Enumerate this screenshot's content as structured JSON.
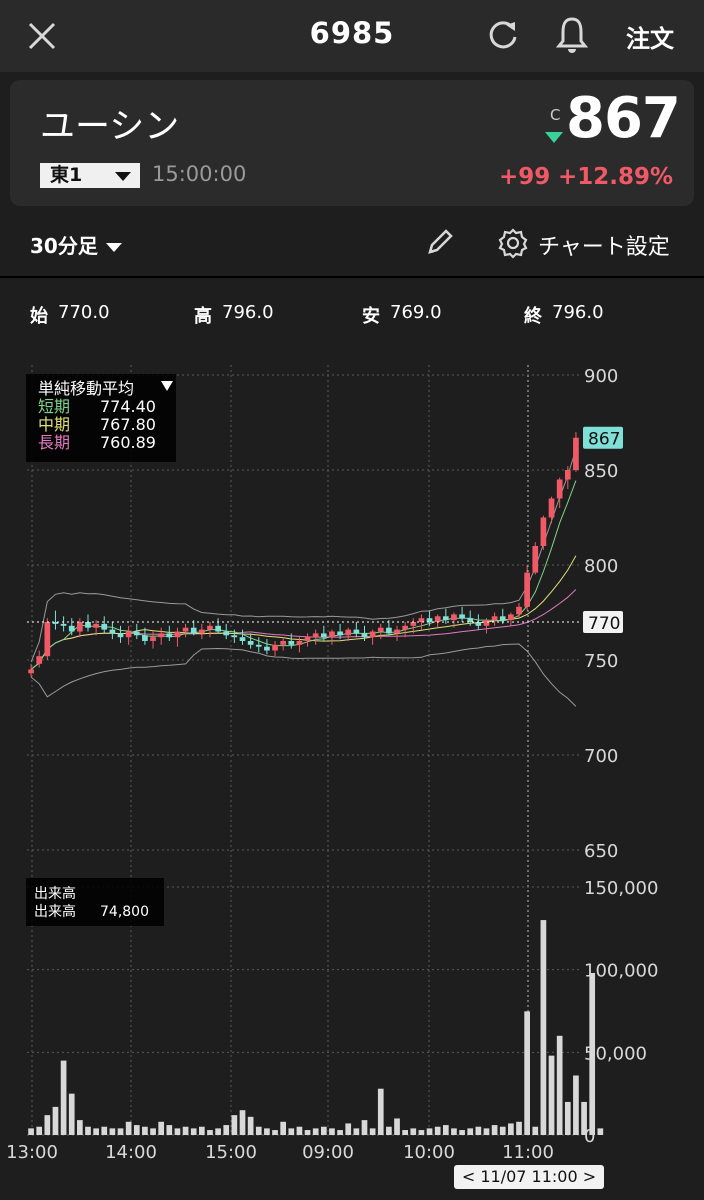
{
  "header": {
    "code": "6985",
    "order_label": "注文",
    "icons": [
      "close-icon",
      "refresh-icon",
      "bell-icon"
    ]
  },
  "stock": {
    "name": "ユーシン",
    "market": "東1",
    "time": "15:00:00",
    "close_mark": "C",
    "price": "867",
    "change": "+99",
    "change_pct": "+12.89%",
    "up_color": "#f05a67",
    "down_color": "#3ad19b"
  },
  "toolbar": {
    "interval": "30分足",
    "settings_label": "チャート設定",
    "icons": [
      "pencil-icon",
      "gear-icon"
    ]
  },
  "ohlc": {
    "open_label": "始",
    "open": "770.0",
    "high_label": "高",
    "high": "796.0",
    "low_label": "安",
    "low": "769.0",
    "close_label": "終",
    "close": "796.0"
  },
  "chart_data": {
    "type": "candlestick",
    "price_axis": {
      "ticks": [
        "900",
        "850",
        "800",
        "750",
        "700",
        "650"
      ],
      "ylim": [
        650,
        900
      ],
      "current_tag": "867",
      "hline_tag": "770"
    },
    "ma_legend": {
      "title": "単純移動平均",
      "short_label": "短期",
      "short_value": "774.40",
      "mid_label": "中期",
      "mid_value": "767.80",
      "long_label": "長期",
      "long_value": "760.89",
      "short_color": "#7fd48a",
      "mid_color": "#e0e07a",
      "long_color": "#e07ac0"
    },
    "volume_legend": {
      "title": "出来高",
      "label": "出来高",
      "value": "74,800"
    },
    "volume_axis": {
      "ticks": [
        "150,000",
        "100,000",
        "50,000",
        "0"
      ],
      "ylim": [
        0,
        150000
      ]
    },
    "x_labels": [
      "13:00",
      "14:00",
      "15:00",
      "09:00",
      "10:00",
      "11:00"
    ],
    "candles_ohlc": [
      [
        743,
        748,
        741,
        745
      ],
      [
        748,
        755,
        746,
        752
      ],
      [
        752,
        772,
        750,
        770
      ],
      [
        770,
        776,
        766,
        769
      ],
      [
        769,
        773,
        765,
        768
      ],
      [
        768,
        772,
        763,
        765
      ],
      [
        765,
        772,
        762,
        770
      ],
      [
        770,
        774,
        765,
        767
      ],
      [
        767,
        771,
        763,
        769
      ],
      [
        769,
        773,
        764,
        766
      ],
      [
        766,
        770,
        761,
        764
      ],
      [
        764,
        768,
        759,
        762
      ],
      [
        762,
        768,
        758,
        765
      ],
      [
        765,
        769,
        761,
        763
      ],
      [
        763,
        767,
        758,
        760
      ],
      [
        760,
        765,
        756,
        762
      ],
      [
        762,
        767,
        758,
        764
      ],
      [
        764,
        768,
        760,
        762
      ],
      [
        762,
        767,
        757,
        765
      ],
      [
        765,
        769,
        762,
        767
      ],
      [
        767,
        771,
        763,
        764
      ],
      [
        764,
        769,
        761,
        766
      ],
      [
        766,
        770,
        762,
        768
      ],
      [
        768,
        772,
        764,
        765
      ],
      [
        765,
        769,
        761,
        763
      ],
      [
        763,
        766,
        759,
        762
      ],
      [
        762,
        766,
        758,
        760
      ],
      [
        760,
        764,
        756,
        758
      ],
      [
        758,
        762,
        754,
        757
      ],
      [
        757,
        761,
        753,
        755
      ],
      [
        755,
        760,
        752,
        758
      ],
      [
        758,
        762,
        755,
        760
      ],
      [
        760,
        764,
        756,
        758
      ],
      [
        758,
        762,
        754,
        760
      ],
      [
        760,
        764,
        757,
        762
      ],
      [
        762,
        766,
        758,
        764
      ],
      [
        764,
        768,
        760,
        762
      ],
      [
        762,
        766,
        758,
        765
      ],
      [
        765,
        769,
        761,
        763
      ],
      [
        763,
        767,
        760,
        766
      ],
      [
        766,
        770,
        762,
        764
      ],
      [
        764,
        768,
        760,
        762
      ],
      [
        762,
        766,
        758,
        765
      ],
      [
        765,
        769,
        761,
        767
      ],
      [
        767,
        771,
        763,
        764
      ],
      [
        764,
        768,
        760,
        766
      ],
      [
        766,
        770,
        762,
        768
      ],
      [
        768,
        772,
        764,
        770
      ],
      [
        770,
        774,
        766,
        772
      ],
      [
        772,
        776,
        768,
        770
      ],
      [
        770,
        774,
        767,
        773
      ],
      [
        773,
        777,
        769,
        771
      ],
      [
        771,
        775,
        767,
        774
      ],
      [
        774,
        778,
        770,
        772
      ],
      [
        772,
        776,
        768,
        770
      ],
      [
        770,
        774,
        766,
        768
      ],
      [
        768,
        772,
        764,
        771
      ],
      [
        771,
        775,
        768,
        773
      ],
      [
        773,
        777,
        769,
        771
      ],
      [
        771,
        775,
        768,
        774
      ],
      [
        774,
        780,
        772,
        778
      ],
      [
        778,
        800,
        776,
        796
      ],
      [
        796,
        812,
        795,
        810
      ],
      [
        810,
        826,
        808,
        825
      ],
      [
        825,
        836,
        822,
        835
      ],
      [
        835,
        846,
        830,
        845
      ],
      [
        845,
        852,
        840,
        850
      ],
      [
        850,
        870,
        849,
        867
      ]
    ],
    "volumes": [
      4000,
      5000,
      12000,
      17000,
      45000,
      25000,
      9000,
      5000,
      4000,
      5000,
      4000,
      4000,
      8000,
      6000,
      5000,
      4000,
      8000,
      6000,
      4000,
      5000,
      4000,
      5000,
      3000,
      4000,
      6000,
      12000,
      15000,
      11000,
      5000,
      4000,
      3000,
      8000,
      4000,
      5000,
      3000,
      4000,
      5000,
      4000,
      3000,
      7000,
      4000,
      9000,
      4000,
      28000,
      5000,
      10000,
      3000,
      4000,
      3000,
      4000,
      5000,
      6000,
      4000,
      3000,
      4000,
      5000,
      4000,
      6000,
      5000,
      7000,
      8000,
      74800,
      5000,
      130000,
      48000,
      60000,
      20000,
      36000,
      20000,
      98000,
      4000
    ]
  }
}
